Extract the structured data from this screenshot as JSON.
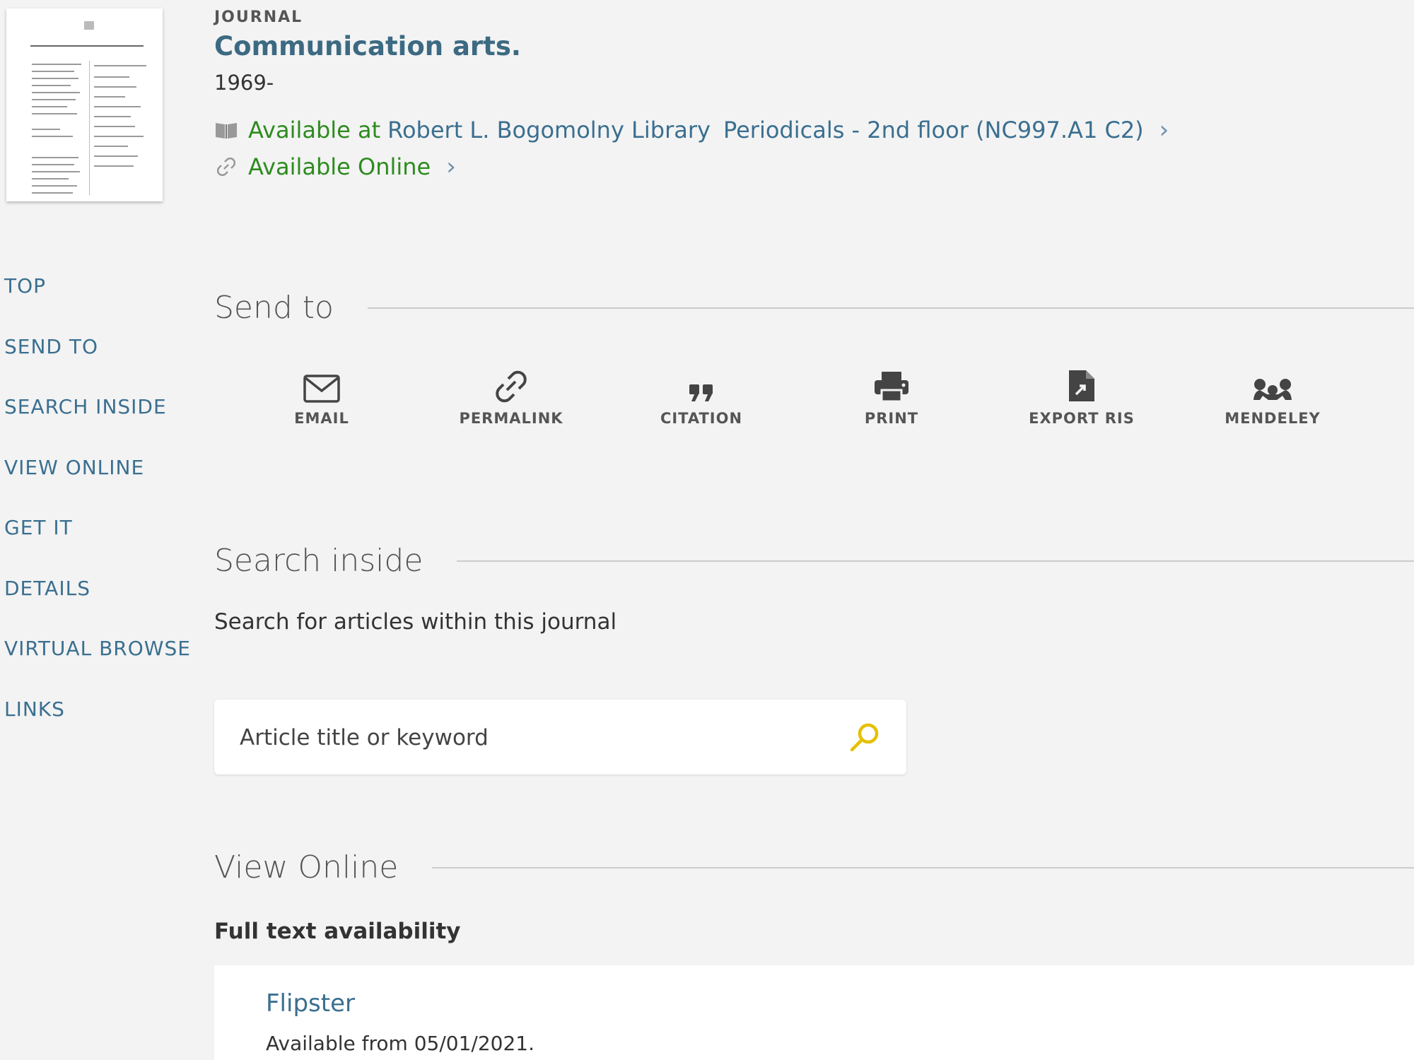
{
  "record": {
    "type": "JOURNAL",
    "title": "Communication arts.",
    "date": "1969-"
  },
  "availability": {
    "physical": {
      "status": "Available at",
      "library": "Robert L. Bogomolny Library",
      "location": "Periodicals - 2nd floor (NC997.A1 C2)",
      "icon": "book-icon"
    },
    "online": {
      "status": "Available Online",
      "icon": "link-icon"
    }
  },
  "left_nav": [
    "TOP",
    "SEND TO",
    "SEARCH INSIDE",
    "VIEW ONLINE",
    "GET IT",
    "DETAILS",
    "VIRTUAL BROWSE",
    "LINKS"
  ],
  "send_to": {
    "heading": "Send to",
    "actions": [
      {
        "label": "EMAIL",
        "icon": "envelope-icon"
      },
      {
        "label": "PERMALINK",
        "icon": "link-icon"
      },
      {
        "label": "CITATION",
        "icon": "quote-icon"
      },
      {
        "label": "PRINT",
        "icon": "printer-icon"
      },
      {
        "label": "EXPORT RIS",
        "icon": "export-file-icon"
      },
      {
        "label": "MENDELEY",
        "icon": "mendeley-icon"
      }
    ]
  },
  "search_inside": {
    "heading": "Search inside",
    "description": "Search for articles within this journal",
    "placeholder": "Article title or keyword",
    "icon": "search-icon"
  },
  "view_online": {
    "heading": "View Online",
    "subheading": "Full text availability",
    "service": "Flipster",
    "note": "Available from 05/01/2021."
  },
  "colors": {
    "accent": "#3a6f90",
    "title": "#3c6a82",
    "available": "#2e8b1f",
    "search_icon": "#e6c000"
  }
}
